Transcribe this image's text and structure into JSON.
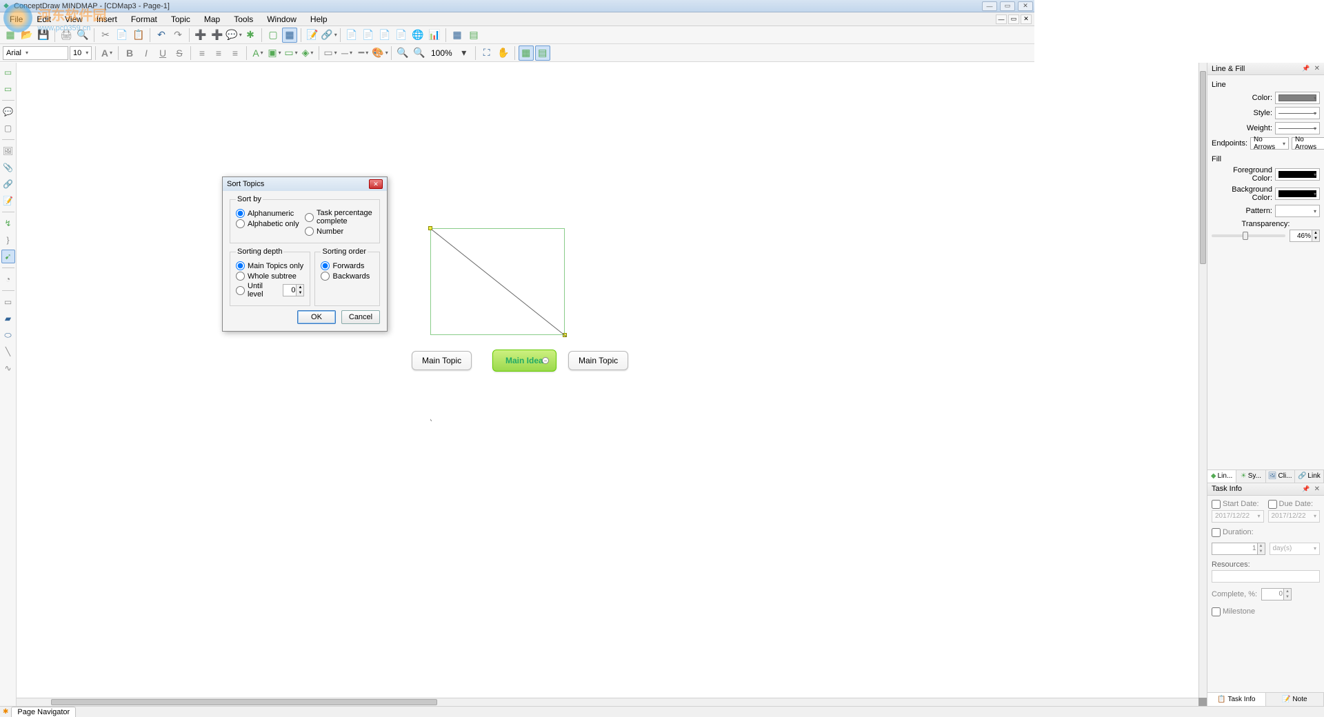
{
  "title": "ConceptDraw MINDMAP - [CDMap3 - Page-1]",
  "watermark": {
    "line1": "河东软件园",
    "line2": "www.pc0359.cn"
  },
  "menu": [
    "File",
    "Edit",
    "View",
    "Insert",
    "Format",
    "Topic",
    "Map",
    "Tools",
    "Window",
    "Help"
  ],
  "font": {
    "family": "Arial",
    "size": "10"
  },
  "zoom": "100%",
  "mindmap": {
    "main": "Main Idea",
    "left": "Main Topic",
    "right": "Main Topic"
  },
  "dialog": {
    "title": "Sort Topics",
    "sortby": {
      "legend": "Sort by",
      "alpha": "Alphanumeric",
      "alphaonly": "Alphabetic only",
      "taskpct": "Task percentage complete",
      "number": "Number"
    },
    "depth": {
      "legend": "Sorting depth",
      "main": "Main Topics only",
      "whole": "Whole subtree",
      "until": "Until level",
      "level": "0"
    },
    "order": {
      "legend": "Sorting order",
      "fwd": "Forwards",
      "bwd": "Backwards"
    },
    "ok": "OK",
    "cancel": "Cancel"
  },
  "linefill": {
    "title": "Line & Fill",
    "line_section": "Line",
    "color": "Color:",
    "style": "Style:",
    "weight": "Weight:",
    "endpoints": "Endpoints:",
    "noarrows": "No Arrows",
    "fill_section": "Fill",
    "fgcolor": "Foreground Color:",
    "bgcolor": "Background Color:",
    "pattern": "Pattern:",
    "transparency": "Transparency:",
    "transval": "46%",
    "tabs": {
      "lin": "Lin...",
      "sy": "Sy...",
      "cli": "Cli...",
      "link": "Link"
    }
  },
  "taskinfo": {
    "title": "Task Info",
    "startdate": "Start Date:",
    "duedate": "Due Date:",
    "date_val": "2017/12/22",
    "duration": "Duration:",
    "dur_val": "1",
    "dur_unit": "day(s)",
    "resources": "Resources:",
    "complete": "Complete, %:",
    "complete_val": "0",
    "milestone": "Milestone",
    "tabs": {
      "task": "Task Info",
      "note": "Note"
    }
  },
  "page_navigator": "Page Navigator"
}
